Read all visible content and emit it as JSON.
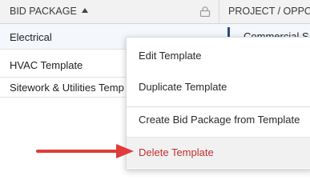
{
  "table": {
    "columns": [
      {
        "label": "BID PACKAGE"
      },
      {
        "label": "PROJECT / OPPOR"
      }
    ],
    "rows": [
      {
        "name": "Electrical",
        "project": "Commercial Sa"
      },
      {
        "name": "HVAC Template"
      },
      {
        "name": "Sitework & Utilities Temp"
      }
    ]
  },
  "context_menu": {
    "items": [
      {
        "label": "Edit Template"
      },
      {
        "label": "Duplicate Template"
      },
      {
        "label": "Create Bid Package from Template"
      },
      {
        "label": "Delete Template"
      }
    ]
  },
  "icons": {
    "sort": "sort-ascending-icon",
    "lock": "lock-icon",
    "annotation": "red-arrow-icon"
  },
  "colors": {
    "delete_text": "#c0312f",
    "annotation_arrow": "#e03b3b",
    "project_bar": "#2d4e7a"
  }
}
